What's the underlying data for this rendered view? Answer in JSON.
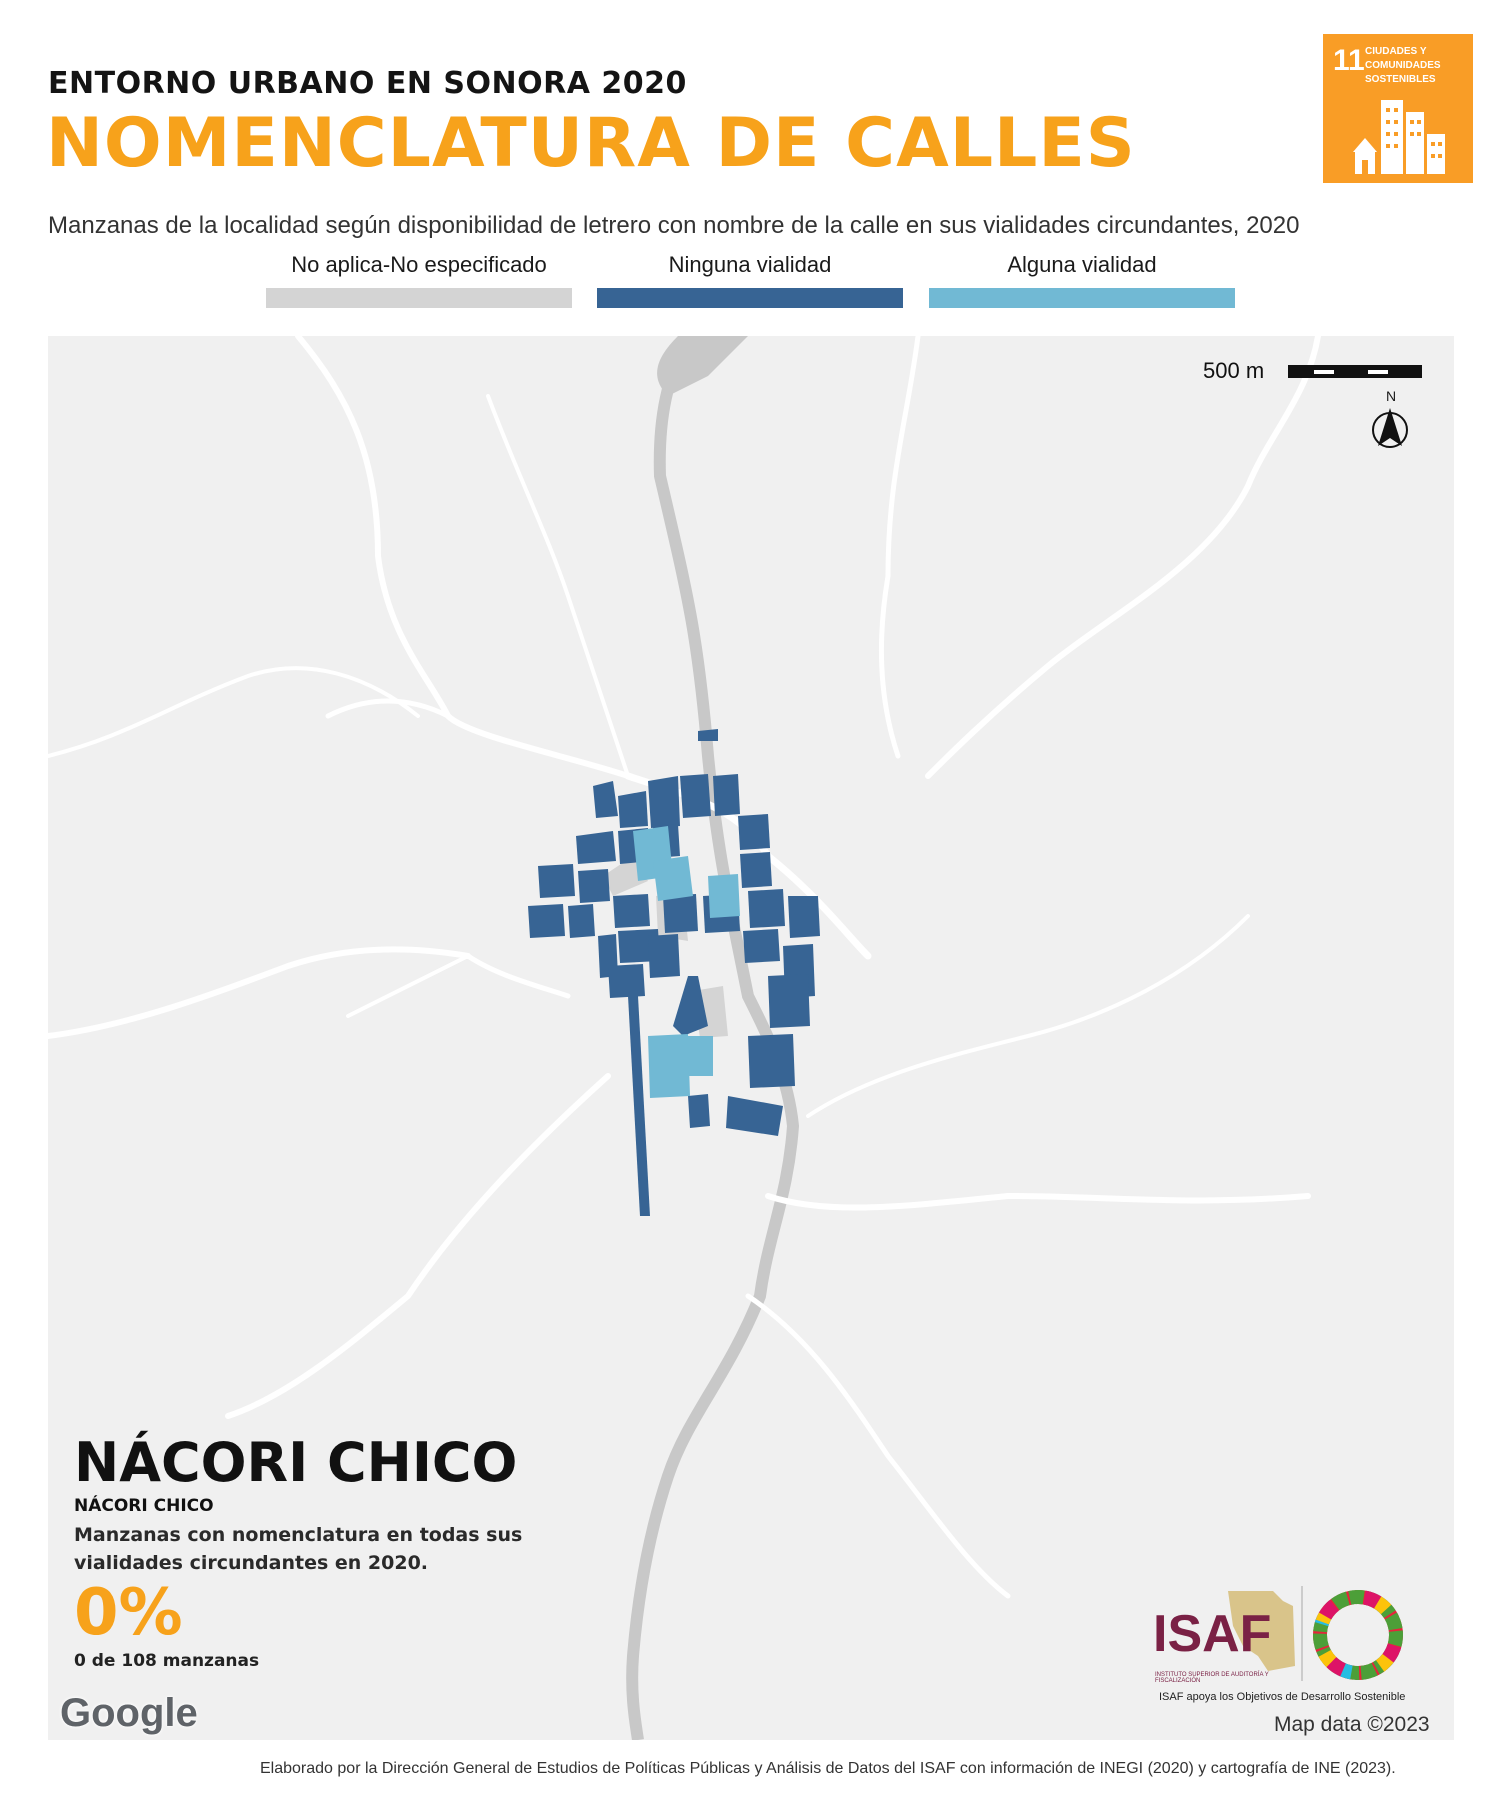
{
  "header": {
    "supertitle": "ENTORNO URBANO EN SONORA 2020",
    "title": "NOMENCLATURA DE CALLES",
    "subtitle": "Manzanas de la localidad según disponibilidad de letrero con nombre de la calle en sus vialidades circundantes, 2020"
  },
  "sdg_badge": {
    "number": "11",
    "text": "CIUDADES Y COMUNIDADES SOSTENIBLES",
    "color": "#f99d26"
  },
  "legend": [
    {
      "label": "No aplica-No especificado",
      "color": "#d4d4d4"
    },
    {
      "label": "Ninguna vialidad",
      "color": "#376494"
    },
    {
      "label": "Alguna vialidad",
      "color": "#71b9d4"
    }
  ],
  "map": {
    "scale_label": "500 m",
    "north_label": "N",
    "google_label": "Google",
    "attribution": "Map data ©2023",
    "locality_name": "NÁCORI CHICO",
    "municipality_name": "NÁCORI CHICO",
    "description": "Manzanas con nomenclatura en todas sus vialidades circundantes en 2020.",
    "percentage": "0%",
    "count_text": "0 de 108 manzanas"
  },
  "logos": {
    "isaf": "ISAF",
    "isaf_subtitle": "INSTITUTO SUPERIOR DE AUDITORÍA Y FISCALIZACIÓN",
    "tagline": "ISAF apoya los Objetivos de Desarrollo Sostenible"
  },
  "footer": "Elaborado por la Dirección General de Estudios de Políticas Públicas y Análisis de Datos del ISAF con información de INEGI (2020) y cartografía de INE (2023)."
}
